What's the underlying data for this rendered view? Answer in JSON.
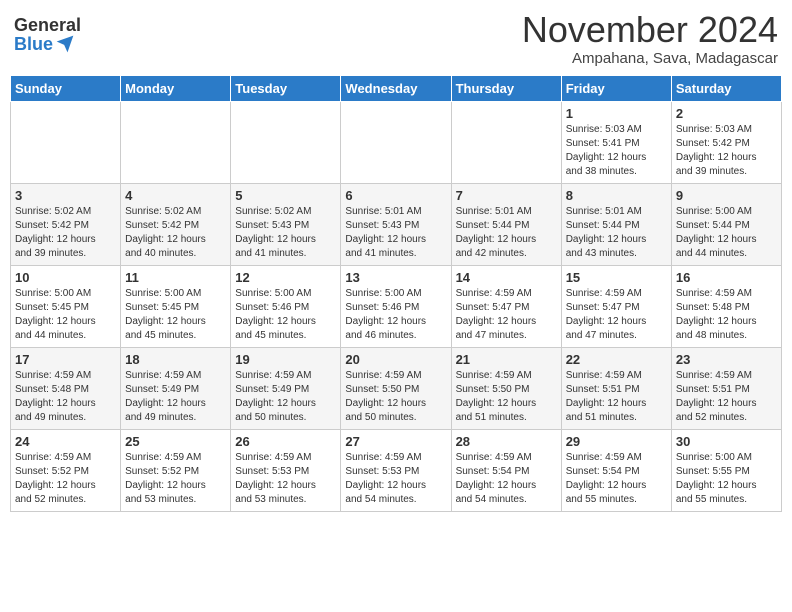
{
  "header": {
    "logo_general": "General",
    "logo_blue": "Blue",
    "month_title": "November 2024",
    "subtitle": "Ampahana, Sava, Madagascar"
  },
  "weekdays": [
    "Sunday",
    "Monday",
    "Tuesday",
    "Wednesday",
    "Thursday",
    "Friday",
    "Saturday"
  ],
  "weeks": [
    [
      {
        "day": "",
        "info": ""
      },
      {
        "day": "",
        "info": ""
      },
      {
        "day": "",
        "info": ""
      },
      {
        "day": "",
        "info": ""
      },
      {
        "day": "",
        "info": ""
      },
      {
        "day": "1",
        "info": "Sunrise: 5:03 AM\nSunset: 5:41 PM\nDaylight: 12 hours\nand 38 minutes."
      },
      {
        "day": "2",
        "info": "Sunrise: 5:03 AM\nSunset: 5:42 PM\nDaylight: 12 hours\nand 39 minutes."
      }
    ],
    [
      {
        "day": "3",
        "info": "Sunrise: 5:02 AM\nSunset: 5:42 PM\nDaylight: 12 hours\nand 39 minutes."
      },
      {
        "day": "4",
        "info": "Sunrise: 5:02 AM\nSunset: 5:42 PM\nDaylight: 12 hours\nand 40 minutes."
      },
      {
        "day": "5",
        "info": "Sunrise: 5:02 AM\nSunset: 5:43 PM\nDaylight: 12 hours\nand 41 minutes."
      },
      {
        "day": "6",
        "info": "Sunrise: 5:01 AM\nSunset: 5:43 PM\nDaylight: 12 hours\nand 41 minutes."
      },
      {
        "day": "7",
        "info": "Sunrise: 5:01 AM\nSunset: 5:44 PM\nDaylight: 12 hours\nand 42 minutes."
      },
      {
        "day": "8",
        "info": "Sunrise: 5:01 AM\nSunset: 5:44 PM\nDaylight: 12 hours\nand 43 minutes."
      },
      {
        "day": "9",
        "info": "Sunrise: 5:00 AM\nSunset: 5:44 PM\nDaylight: 12 hours\nand 44 minutes."
      }
    ],
    [
      {
        "day": "10",
        "info": "Sunrise: 5:00 AM\nSunset: 5:45 PM\nDaylight: 12 hours\nand 44 minutes."
      },
      {
        "day": "11",
        "info": "Sunrise: 5:00 AM\nSunset: 5:45 PM\nDaylight: 12 hours\nand 45 minutes."
      },
      {
        "day": "12",
        "info": "Sunrise: 5:00 AM\nSunset: 5:46 PM\nDaylight: 12 hours\nand 45 minutes."
      },
      {
        "day": "13",
        "info": "Sunrise: 5:00 AM\nSunset: 5:46 PM\nDaylight: 12 hours\nand 46 minutes."
      },
      {
        "day": "14",
        "info": "Sunrise: 4:59 AM\nSunset: 5:47 PM\nDaylight: 12 hours\nand 47 minutes."
      },
      {
        "day": "15",
        "info": "Sunrise: 4:59 AM\nSunset: 5:47 PM\nDaylight: 12 hours\nand 47 minutes."
      },
      {
        "day": "16",
        "info": "Sunrise: 4:59 AM\nSunset: 5:48 PM\nDaylight: 12 hours\nand 48 minutes."
      }
    ],
    [
      {
        "day": "17",
        "info": "Sunrise: 4:59 AM\nSunset: 5:48 PM\nDaylight: 12 hours\nand 49 minutes."
      },
      {
        "day": "18",
        "info": "Sunrise: 4:59 AM\nSunset: 5:49 PM\nDaylight: 12 hours\nand 49 minutes."
      },
      {
        "day": "19",
        "info": "Sunrise: 4:59 AM\nSunset: 5:49 PM\nDaylight: 12 hours\nand 50 minutes."
      },
      {
        "day": "20",
        "info": "Sunrise: 4:59 AM\nSunset: 5:50 PM\nDaylight: 12 hours\nand 50 minutes."
      },
      {
        "day": "21",
        "info": "Sunrise: 4:59 AM\nSunset: 5:50 PM\nDaylight: 12 hours\nand 51 minutes."
      },
      {
        "day": "22",
        "info": "Sunrise: 4:59 AM\nSunset: 5:51 PM\nDaylight: 12 hours\nand 51 minutes."
      },
      {
        "day": "23",
        "info": "Sunrise: 4:59 AM\nSunset: 5:51 PM\nDaylight: 12 hours\nand 52 minutes."
      }
    ],
    [
      {
        "day": "24",
        "info": "Sunrise: 4:59 AM\nSunset: 5:52 PM\nDaylight: 12 hours\nand 52 minutes."
      },
      {
        "day": "25",
        "info": "Sunrise: 4:59 AM\nSunset: 5:52 PM\nDaylight: 12 hours\nand 53 minutes."
      },
      {
        "day": "26",
        "info": "Sunrise: 4:59 AM\nSunset: 5:53 PM\nDaylight: 12 hours\nand 53 minutes."
      },
      {
        "day": "27",
        "info": "Sunrise: 4:59 AM\nSunset: 5:53 PM\nDaylight: 12 hours\nand 54 minutes."
      },
      {
        "day": "28",
        "info": "Sunrise: 4:59 AM\nSunset: 5:54 PM\nDaylight: 12 hours\nand 54 minutes."
      },
      {
        "day": "29",
        "info": "Sunrise: 4:59 AM\nSunset: 5:54 PM\nDaylight: 12 hours\nand 55 minutes."
      },
      {
        "day": "30",
        "info": "Sunrise: 5:00 AM\nSunset: 5:55 PM\nDaylight: 12 hours\nand 55 minutes."
      }
    ]
  ]
}
